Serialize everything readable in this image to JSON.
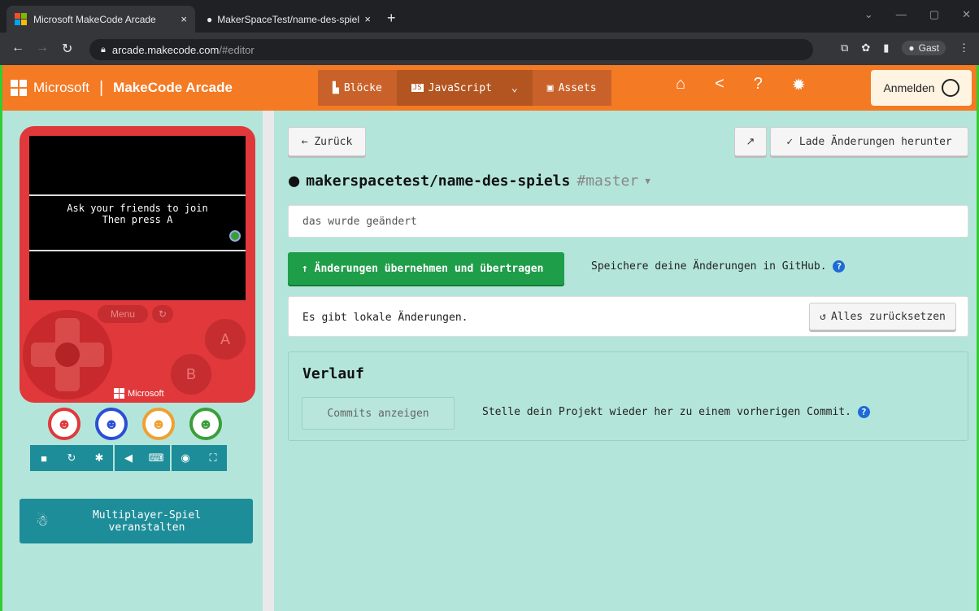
{
  "browser": {
    "tabs": [
      {
        "title": "Microsoft MakeCode Arcade",
        "close": "×"
      },
      {
        "title": "MakerSpaceTest/name-des-spiel",
        "close": "×"
      }
    ],
    "new_tab": "+",
    "url_host": "arcade.makecode.com",
    "url_hash": "/#editor",
    "profile": "Gast"
  },
  "header": {
    "brand": "Microsoft",
    "product": "MakeCode Arcade",
    "modes": [
      {
        "label": "Blöcke",
        "icon": "puzzle-icon"
      },
      {
        "label": "JavaScript",
        "icon": "js-icon"
      },
      {
        "label": "Assets",
        "icon": "image-icon"
      }
    ],
    "signin": "Anmelden"
  },
  "simulator": {
    "screen_line1": "Ask your friends to join",
    "screen_line2": "Then press A",
    "menu": "Menu",
    "btn_a": "A",
    "btn_b": "B",
    "ms_label": "Microsoft",
    "player_colors": [
      "#e0383b",
      "#2a4fd6",
      "#f0a030",
      "#3a9e3a"
    ],
    "multiplayer_label": "Multiplayer-Spiel veranstalten"
  },
  "github": {
    "back": "← Zurück",
    "download": "✓ Lade Änderungen herunter",
    "repo": "makerspacetest/name-des-spiels",
    "branch": "#master",
    "commit_message": "das wurde geändert",
    "commit_button": "↑ Änderungen übernehmen und übertragen",
    "save_hint": "Speichere deine Änderungen in GitHub.",
    "local_changes": "Es gibt lokale Änderungen.",
    "revert_button": "Alles zurücksetzen",
    "history_title": "Verlauf",
    "show_commits": "Commits anzeigen",
    "history_hint": "Stelle dein Projekt wieder her zu einem vorherigen Commit."
  }
}
